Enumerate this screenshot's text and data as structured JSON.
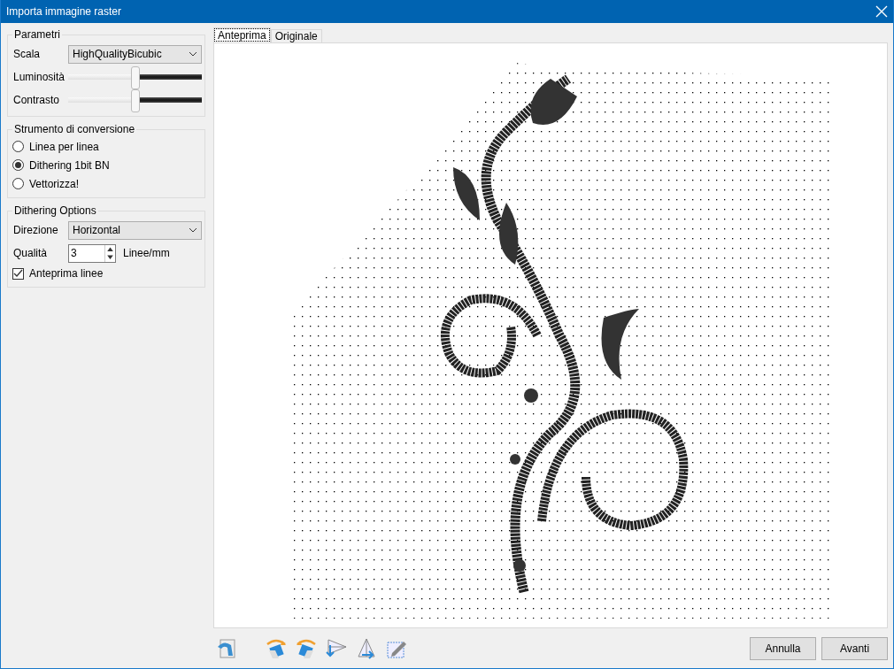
{
  "window": {
    "title": "Importa immagine raster"
  },
  "parameters": {
    "title": "Parametri",
    "scale": {
      "label": "Scala",
      "value": "HighQualityBicubic"
    },
    "sliders": [
      {
        "label": "Luminosità",
        "level": 0.5
      },
      {
        "label": "Contrasto",
        "level": 0.5
      }
    ]
  },
  "conversion": {
    "title": "Strumento di conversione",
    "options": [
      {
        "label": "Linea per linea",
        "selected": false
      },
      {
        "label": "Dithering 1bit BN",
        "selected": true
      },
      {
        "label": "Vettorizza!",
        "selected": false
      }
    ]
  },
  "dithering": {
    "title": "Dithering Options",
    "direction": {
      "label": "Direzione",
      "value": "Horizontal"
    },
    "quality": {
      "label": "Qualità",
      "value": "3",
      "unit": "Linee/mm"
    },
    "preview_lines": {
      "label": "Anteprima linee",
      "checked": true
    }
  },
  "tabs": [
    {
      "label": "Anteprima",
      "selected": true
    },
    {
      "label": "Originale",
      "selected": false
    }
  ],
  "toolbar": [
    {
      "kind": "reset"
    },
    {
      "kind": "rotate-left"
    },
    {
      "kind": "rotate-right"
    },
    {
      "kind": "flip-h"
    },
    {
      "kind": "flip-v"
    },
    {
      "kind": "crop"
    }
  ],
  "buttons": [
    "Annulla",
    "Avanti"
  ]
}
